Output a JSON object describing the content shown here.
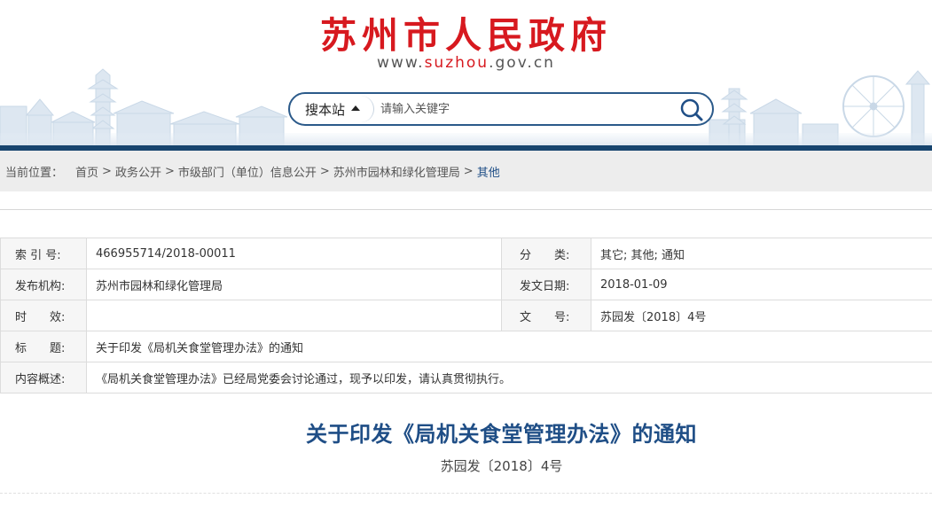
{
  "header": {
    "site_title": "苏州市人民政府",
    "url_prefix": "www.",
    "url_highlight": "suzhou",
    "url_suffix": ".gov.cn",
    "brand_red": "#d7191f",
    "brand_blue": "#17456f"
  },
  "search": {
    "scope_label": "搜本站",
    "placeholder": "请输入关键字",
    "icon": "search-icon"
  },
  "breadcrumb": {
    "prefix": "当前位置：",
    "items": [
      "首页",
      "政务公开",
      "市级部门（单位）信息公开",
      "苏州市园林和绿化管理局",
      "其他"
    ],
    "separator": ">"
  },
  "info": {
    "index_label": "索 引 号:",
    "index_value": "466955714/2018-00011",
    "category_label": "分　　类:",
    "category_value": "其它;  其他;  通知",
    "publisher_label": "发布机构:",
    "publisher_value": "苏州市园林和绿化管理局",
    "date_label": "发文日期:",
    "date_value": "2018-01-09",
    "validity_label": "时　　效:",
    "validity_value": "",
    "docno_label": "文　　号:",
    "docno_value": "苏园发〔2018〕4号",
    "title_label": "标　　题:",
    "title_value": "关于印发《局机关食堂管理办法》的通知",
    "summary_label": "内容概述:",
    "summary_value": "《局机关食堂管理办法》已经局党委会讨论通过，现予以印发，请认真贯彻执行。"
  },
  "article": {
    "title": "关于印发《局机关食堂管理办法》的通知",
    "doc_number": "苏园发〔2018〕4号"
  }
}
